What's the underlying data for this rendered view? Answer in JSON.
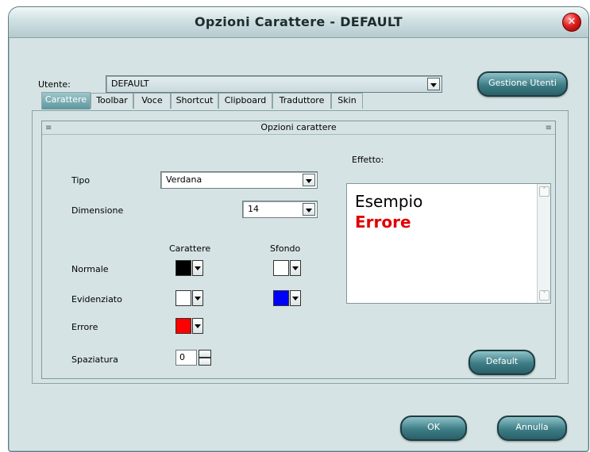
{
  "window": {
    "title": "Opzioni Carattere - DEFAULT"
  },
  "user": {
    "label": "Utente:",
    "value": "DEFAULT",
    "manage_button": "Gestione Utenti"
  },
  "tabs": [
    {
      "label": "Carattere",
      "active": true
    },
    {
      "label": "Toolbar"
    },
    {
      "label": "Voce"
    },
    {
      "label": "Shortcut"
    },
    {
      "label": "Clipboard"
    },
    {
      "label": "Traduttore"
    },
    {
      "label": "Skin"
    }
  ],
  "section": {
    "title": "Opzioni carattere"
  },
  "font": {
    "type_label": "Tipo",
    "type_value": "Verdana",
    "size_label": "Dimensione",
    "size_value": "14"
  },
  "colors": {
    "col_character": "Carattere",
    "col_background": "Sfondo",
    "rows": [
      {
        "label": "Normale",
        "character": "#000000",
        "background": "#ffffff"
      },
      {
        "label": "Evidenziato",
        "character": "#ffffff",
        "background": "#0000ff"
      },
      {
        "label": "Errore",
        "character": "#ff0000"
      }
    ]
  },
  "spacing": {
    "label": "Spaziatura",
    "value": "0"
  },
  "effect": {
    "label": "Effetto:",
    "sample_text": "Esempio",
    "error_text": "Errore",
    "error_color": "#e00000"
  },
  "buttons": {
    "default": "Default",
    "ok": "OK",
    "cancel": "Annulla"
  }
}
